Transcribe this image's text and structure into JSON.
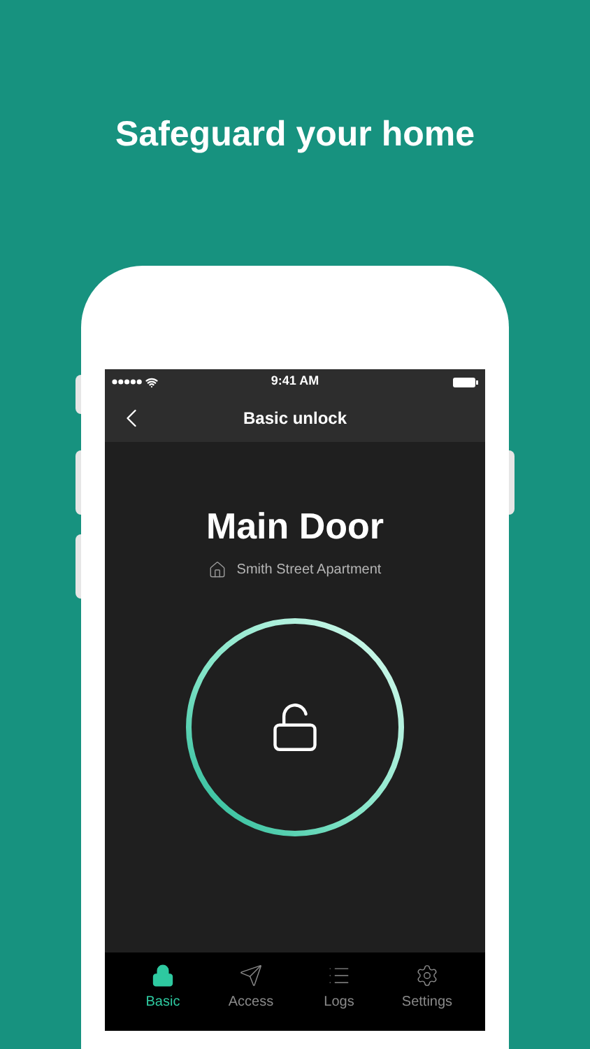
{
  "headline": "Safeguard your home",
  "status_bar": {
    "time": "9:41 AM"
  },
  "nav": {
    "title": "Basic unlock"
  },
  "door": {
    "name": "Main Door",
    "location": "Smith Street Apartment",
    "locked": false
  },
  "tabs": [
    {
      "label": "Basic",
      "kind": "lock",
      "selected": true
    },
    {
      "label": "Access",
      "kind": "send",
      "selected": false
    },
    {
      "label": "Logs",
      "kind": "list",
      "selected": false
    },
    {
      "label": "Settings",
      "kind": "gear",
      "selected": false
    }
  ]
}
